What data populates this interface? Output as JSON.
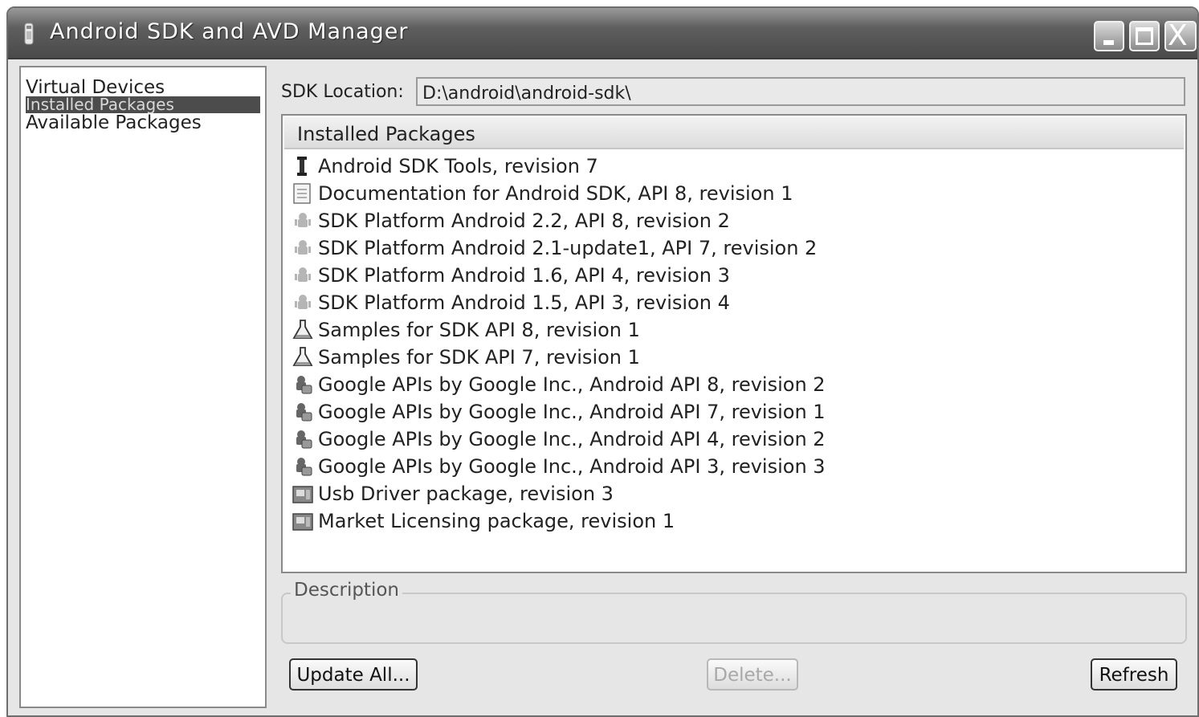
{
  "window": {
    "title": "Android SDK and AVD Manager",
    "icon": "android-icon",
    "controls": [
      "minimize",
      "maximize",
      "close"
    ],
    "close_glyph": "X"
  },
  "sidebar": {
    "items": [
      {
        "label": "Virtual Devices",
        "selected": false
      },
      {
        "label": "Installed Packages",
        "selected": true
      },
      {
        "label": "Available Packages",
        "selected": false
      }
    ]
  },
  "sdk": {
    "label": "SDK Location:",
    "value": "D:\\android\\android-sdk\\"
  },
  "packages": {
    "header": "Installed Packages",
    "items": [
      {
        "icon": "tools-icon",
        "label": "Android SDK Tools, revision 7"
      },
      {
        "icon": "document-icon",
        "label": "Documentation for Android SDK, API 8, revision 1"
      },
      {
        "icon": "android-platform-icon",
        "label": "SDK Platform Android 2.2, API 8, revision 2"
      },
      {
        "icon": "android-platform-icon",
        "label": "SDK Platform Android 2.1-update1, API 7, revision 2"
      },
      {
        "icon": "android-platform-icon",
        "label": "SDK Platform Android 1.6, API 4, revision 3"
      },
      {
        "icon": "android-platform-icon",
        "label": "SDK Platform Android 1.5, API 3, revision 4"
      },
      {
        "icon": "flask-icon",
        "label": "Samples for SDK API 8, revision 1"
      },
      {
        "icon": "flask-icon",
        "label": "Samples for SDK API 7, revision 1"
      },
      {
        "icon": "google-addon-icon",
        "label": "Google APIs by Google Inc., Android API 8, revision 2"
      },
      {
        "icon": "google-addon-icon",
        "label": "Google APIs by Google Inc., Android API 7, revision 1"
      },
      {
        "icon": "google-addon-icon",
        "label": "Google APIs by Google Inc., Android API 4, revision 2"
      },
      {
        "icon": "google-addon-icon",
        "label": "Google APIs by Google Inc., Android API 3, revision 3"
      },
      {
        "icon": "package-icon",
        "label": "Usb Driver package, revision 3"
      },
      {
        "icon": "package-icon",
        "label": "Market Licensing package, revision 1"
      }
    ]
  },
  "description": {
    "legend": "Description",
    "text": ""
  },
  "buttons": {
    "update_all": "Update All...",
    "delete": "Delete...",
    "refresh": "Refresh"
  }
}
